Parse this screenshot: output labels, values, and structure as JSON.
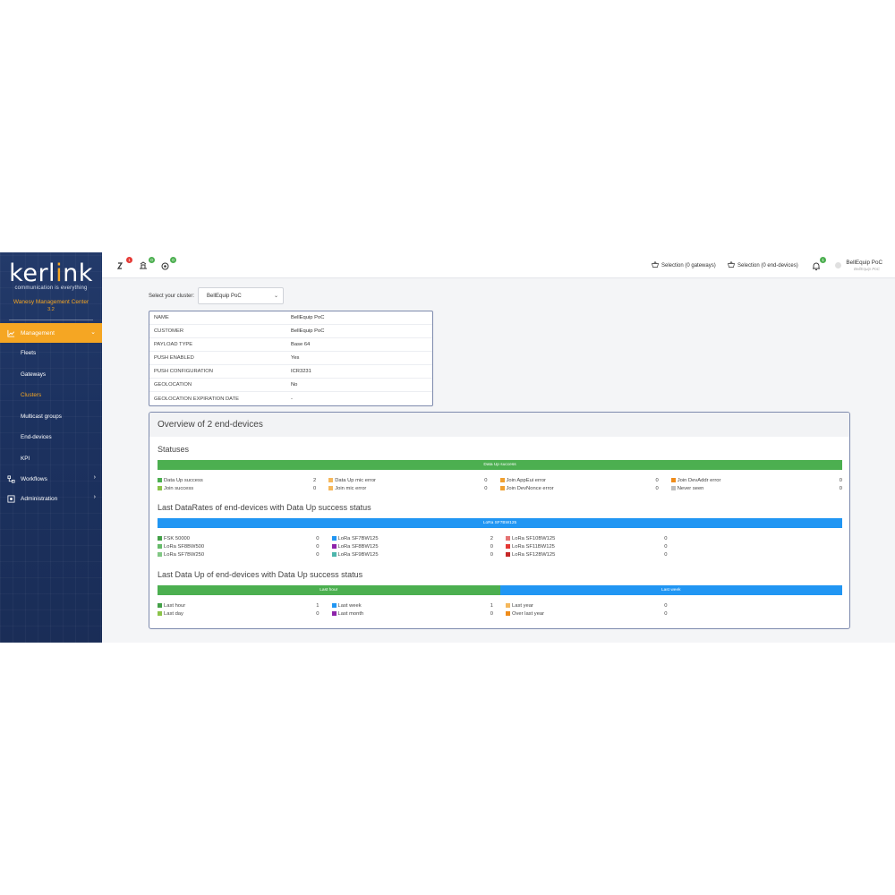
{
  "brand": {
    "logo_pre": "kerl",
    "logo_dot": "i",
    "logo_post": "nk",
    "tagline": "communication is everything",
    "product": "Wanesy Management Center",
    "version": "3.2"
  },
  "sidebar": {
    "management": "Management",
    "items": [
      "Fleets",
      "Gateways",
      "Clusters",
      "Multicast groups",
      "End-devices",
      "KPI"
    ],
    "workflows": "Workflows",
    "administration": "Administration"
  },
  "topbar": {
    "badge1": "1",
    "badge2": "0",
    "badge3": "0",
    "badge4": "1",
    "sel_gateways": "Selection (0 gateways)",
    "sel_devices": "Selection (0 end-devices)",
    "user": "BellEquip PoC",
    "user_sub": "BellEquip PoC"
  },
  "cluster": {
    "label": "Select your cluster:",
    "value": "BellEquip PoC"
  },
  "info": [
    {
      "key": "NAME",
      "val": "BellEquip PoC"
    },
    {
      "key": "CUSTOMER",
      "val": "BellEquip PoC"
    },
    {
      "key": "PAYLOAD TYPE",
      "val": "Base 64"
    },
    {
      "key": "PUSH ENABLED",
      "val": "Yes"
    },
    {
      "key": "PUSH CONFIGURATION",
      "val": "ICR3231"
    },
    {
      "key": "GEOLOCATION",
      "val": "No"
    },
    {
      "key": "GEOLOCATION EXPIRATION DATE",
      "val": "-"
    }
  ],
  "overview": {
    "title": "Overview of 2 end-devices",
    "statuses": {
      "title": "Statuses",
      "bar": [
        {
          "label": "Data Up success",
          "fraction": 1.0,
          "color": "#4caf50"
        }
      ],
      "rows": [
        [
          {
            "label": "Data Up success",
            "count": "2",
            "color": "#4caf50"
          },
          {
            "label": "Data Up mic error",
            "count": "0",
            "color": "#f5b85c"
          },
          {
            "label": "Join AppEui error",
            "count": "0",
            "color": "#f0a030"
          },
          {
            "label": "Join DevAddr error",
            "count": "0",
            "color": "#ef8c1a"
          }
        ],
        [
          {
            "label": "Join success",
            "count": "0",
            "color": "#8bc34a"
          },
          {
            "label": "Join mic error",
            "count": "0",
            "color": "#f5b85c"
          },
          {
            "label": "Join DevNonce error",
            "count": "0",
            "color": "#f0a030"
          },
          {
            "label": "Never seen",
            "count": "0",
            "color": "#bdbdbd"
          }
        ]
      ]
    },
    "datarates": {
      "title": "Last DataRates of end-devices with Data Up success status",
      "bar": [
        {
          "label": "LoRa SF7BW125",
          "fraction": 1.0,
          "color": "#2196f3"
        }
      ],
      "rows": [
        [
          {
            "label": "FSK 50000",
            "count": "0",
            "color": "#43a047"
          },
          {
            "label": "LoRa SF7BW125",
            "count": "2",
            "color": "#2196f3"
          },
          {
            "label": "LoRa SF10BW125",
            "count": "0",
            "color": "#e57373"
          }
        ],
        [
          {
            "label": "LoRa SF8BW500",
            "count": "0",
            "color": "#66bb6a"
          },
          {
            "label": "LoRa SF8BW125",
            "count": "0",
            "color": "#8e24aa"
          },
          {
            "label": "LoRa SF11BW125",
            "count": "0",
            "color": "#e53935"
          }
        ],
        [
          {
            "label": "LoRa SF7BW250",
            "count": "0",
            "color": "#81c784"
          },
          {
            "label": "LoRa SF9BW125",
            "count": "0",
            "color": "#4db6ac"
          },
          {
            "label": "LoRa SF12BW125",
            "count": "0",
            "color": "#c62828"
          }
        ]
      ]
    },
    "lastup": {
      "title": "Last Data Up of end-devices with Data Up success status",
      "bar": [
        {
          "label": "Last hour",
          "fraction": 0.5,
          "color": "#4caf50"
        },
        {
          "label": "Last week",
          "fraction": 0.5,
          "color": "#2196f3"
        }
      ],
      "rows": [
        [
          {
            "label": "Last hour",
            "count": "1",
            "color": "#43a047"
          },
          {
            "label": "Last week",
            "count": "1",
            "color": "#2196f3"
          },
          {
            "label": "Last year",
            "count": "0",
            "color": "#f5b85c"
          }
        ],
        [
          {
            "label": "Last day",
            "count": "0",
            "color": "#8bc34a"
          },
          {
            "label": "Last month",
            "count": "0",
            "color": "#8e24aa"
          },
          {
            "label": "Over last year",
            "count": "0",
            "color": "#ef8c1a"
          }
        ]
      ]
    }
  }
}
